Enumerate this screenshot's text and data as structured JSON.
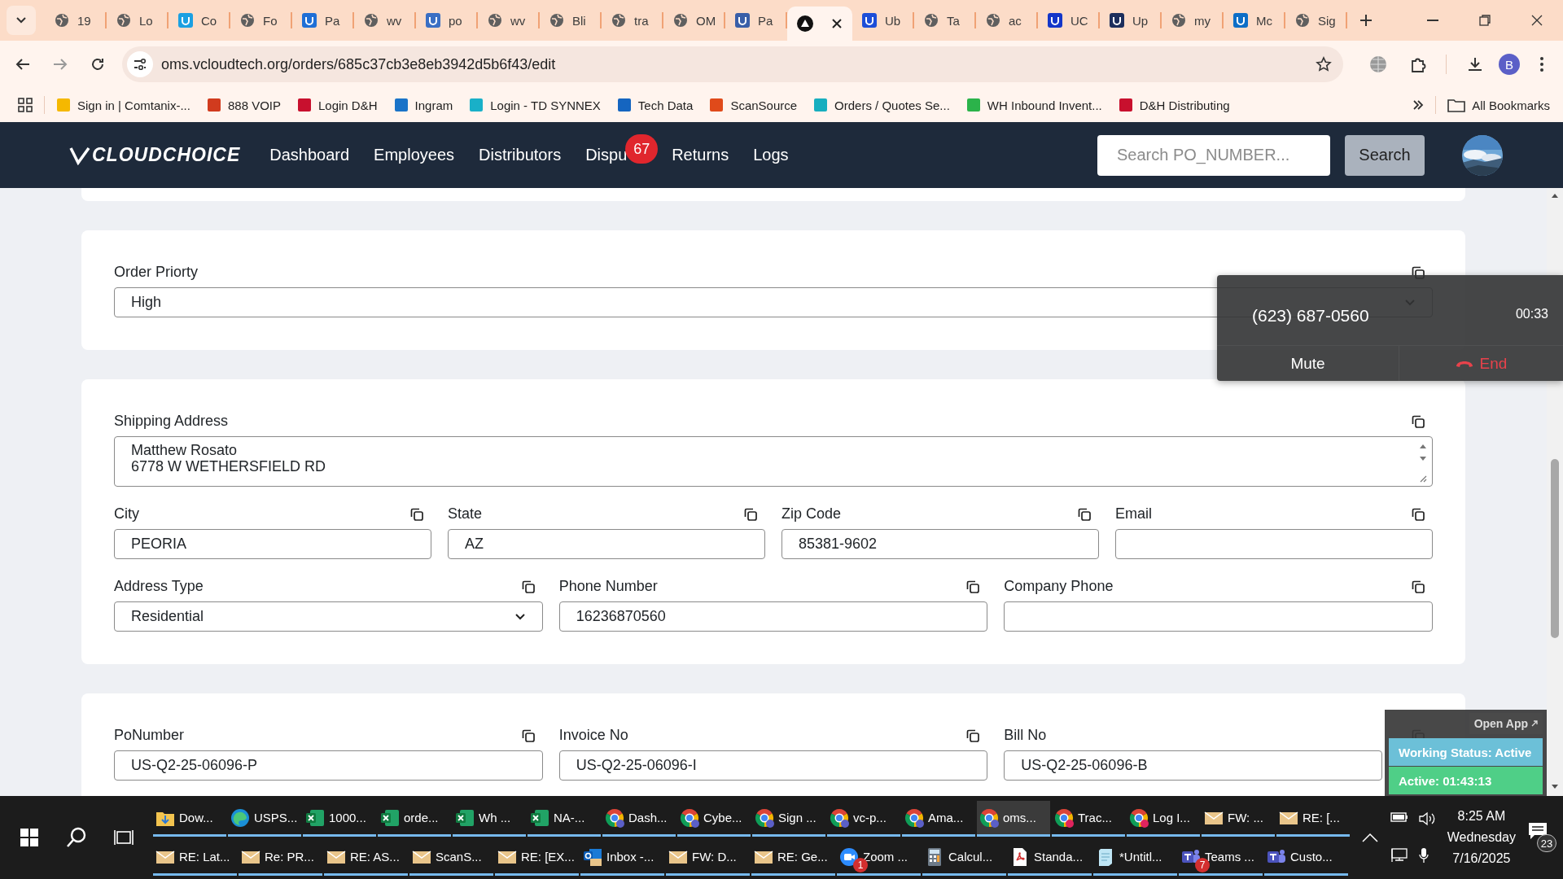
{
  "browser": {
    "tabs": [
      {
        "title": "19",
        "kind": "globe",
        "selected": false
      },
      {
        "title": "Lo",
        "kind": "globe",
        "selected": false
      },
      {
        "title": "Co",
        "kind": "favicon",
        "color": "#1ba0e2",
        "selected": false
      },
      {
        "title": "Fo",
        "kind": "globe",
        "selected": false
      },
      {
        "title": "Pa",
        "kind": "favicon",
        "color": "#1f6fd6",
        "selected": false
      },
      {
        "title": "wv",
        "kind": "globe",
        "selected": false
      },
      {
        "title": "po",
        "kind": "favicon",
        "color": "#3a6fc4",
        "selected": false
      },
      {
        "title": "wv",
        "kind": "globe",
        "selected": false
      },
      {
        "title": "Bli",
        "kind": "globe",
        "selected": false
      },
      {
        "title": "tra",
        "kind": "globe",
        "selected": false
      },
      {
        "title": "OM",
        "kind": "globe",
        "selected": false
      },
      {
        "title": "Pa",
        "kind": "favicon",
        "color": "#3a5fa8",
        "selected": false
      },
      {
        "kind": "app",
        "selected": true
      },
      {
        "title": "Ub",
        "kind": "favicon",
        "color": "#1d4ed8",
        "selected": false
      },
      {
        "title": "Ta",
        "kind": "globe",
        "selected": false
      },
      {
        "title": "ac",
        "kind": "globe",
        "selected": false
      },
      {
        "title": "UC",
        "kind": "favicon",
        "color": "#1436c9",
        "selected": false
      },
      {
        "title": "Up",
        "kind": "favicon",
        "color": "#1c2e5c",
        "selected": false
      },
      {
        "title": "my",
        "kind": "globe",
        "selected": false
      },
      {
        "title": "Mc",
        "kind": "favicon",
        "color": "#0d6ec7",
        "selected": false
      },
      {
        "title": "Sig",
        "kind": "globe",
        "selected": false
      }
    ],
    "url": "oms.vcloudtech.org/orders/685c37cb3e8eb3942d5b6f43/edit",
    "profile": "B"
  },
  "bookmarks": {
    "items": [
      {
        "label": "Sign in | Comtanix-...",
        "color": "#f5b800"
      },
      {
        "label": "888 VOIP",
        "color": "#d13b1e"
      },
      {
        "label": "Login D&H",
        "color": "#c8102e"
      },
      {
        "label": "Ingram",
        "color": "#1a73c8"
      },
      {
        "label": "Login - TD SYNNEX",
        "color": "#19b0c8"
      },
      {
        "label": "Tech Data",
        "color": "#1565c0"
      },
      {
        "label": "ScanSource",
        "color": "#e04a1a"
      },
      {
        "label": "Orders / Quotes Se...",
        "color": "#17aebf"
      },
      {
        "label": "WH Inbound Invent...",
        "color": "#2bb34a"
      },
      {
        "label": "D&H Distributing",
        "color": "#c8102e"
      }
    ],
    "all": "All Bookmarks"
  },
  "app": {
    "brand": "CLOUDCHOICE",
    "nav": [
      {
        "label": "Dashboard"
      },
      {
        "label": "Employees"
      },
      {
        "label": "Distributors"
      },
      {
        "label": "Dispu",
        "badge": "67"
      },
      {
        "label": "Returns"
      },
      {
        "label": "Logs"
      }
    ],
    "search": {
      "placeholder": "Search PO_NUMBER..."
    },
    "search_button": "Search"
  },
  "form": {
    "sections": [
      {
        "rows": [
          [
            {
              "label": "Order Priorty",
              "kind": "select",
              "value": "High"
            }
          ]
        ]
      },
      {
        "rows": [
          [
            {
              "label": "Shipping Address",
              "kind": "textarea",
              "value": "Matthew Rosato\n6778 W WETHERSFIELD RD"
            }
          ],
          [
            {
              "label": "City",
              "kind": "text",
              "value": "PEORIA"
            },
            {
              "label": "State",
              "kind": "text",
              "value": "AZ"
            },
            {
              "label": "Zip Code",
              "kind": "text",
              "value": "85381-9602"
            },
            {
              "label": "Email",
              "kind": "text"
            }
          ],
          [
            {
              "label": "Address Type",
              "kind": "select",
              "value": "Residential"
            },
            {
              "label": "Phone Number",
              "kind": "text",
              "value": "16236870560"
            },
            {
              "label": "Company Phone",
              "kind": "text"
            }
          ]
        ]
      },
      {
        "rows": [
          [
            {
              "label": "PoNumber",
              "kind": "text",
              "value": "US-Q2-25-06096-P"
            },
            {
              "label": "Invoice No",
              "kind": "text",
              "value": "US-Q2-25-06096-I"
            },
            {
              "label": "Bill No",
              "kind": "text",
              "value": "US-Q2-25-06096-B"
            }
          ]
        ]
      }
    ]
  },
  "call_widget": {
    "number": "(623) 687-0560",
    "timer": "00:33",
    "mute": "Mute",
    "end": "End"
  },
  "status_overlay": {
    "open_app": "Open App",
    "working_status": "Working Status: Active",
    "active_time": "Active: 01:43:13"
  },
  "taskbar": {
    "upper_row": [
      {
        "label": "Dow...",
        "kind": "folder",
        "selected": false
      },
      {
        "label": "USPS...",
        "kind": "edge",
        "selected": false
      },
      {
        "label": "1000...",
        "kind": "excel",
        "selected": false
      },
      {
        "label": "orde...",
        "kind": "excel",
        "selected": false
      },
      {
        "label": "Wh ...",
        "kind": "excel",
        "selected": false
      },
      {
        "label": "NA-...",
        "kind": "excel",
        "selected": false
      },
      {
        "label": "Dash...",
        "kind": "chrome",
        "selected": false
      },
      {
        "label": "Cybe...",
        "kind": "chrome",
        "selected": false
      },
      {
        "label": "Sign ...",
        "kind": "chrome",
        "selected": false
      },
      {
        "label": "vc-p...",
        "kind": "chrome",
        "selected": false
      },
      {
        "label": "Ama...",
        "kind": "chrome",
        "selected": false
      },
      {
        "label": "oms...",
        "kind": "chrome",
        "selected": true
      },
      {
        "label": "Trac...",
        "kind": "chrome-rec",
        "selected": false
      },
      {
        "label": "Log I...",
        "kind": "chrome-rec",
        "selected": false
      },
      {
        "label": "FW: ...",
        "kind": "mail",
        "selected": false
      },
      {
        "label": "RE: [...",
        "kind": "mail",
        "selected": false
      }
    ],
    "lower_row": [
      {
        "label": "RE: Lat...",
        "kind": "mail",
        "selected": false
      },
      {
        "label": "Re: PR...",
        "kind": "mail",
        "selected": false
      },
      {
        "label": "RE: AS...",
        "kind": "mail",
        "selected": false
      },
      {
        "label": "ScanS...",
        "kind": "mail",
        "selected": false
      },
      {
        "label": "RE: [EX...",
        "kind": "mail",
        "selected": false
      },
      {
        "label": "Inbox -...",
        "kind": "outlook",
        "selected": false
      },
      {
        "label": "FW: D...",
        "kind": "mail",
        "selected": false
      },
      {
        "label": "RE: Ge...",
        "kind": "mail",
        "selected": false
      },
      {
        "label": "Zoom ...",
        "kind": "zoom",
        "badge": "1",
        "selected": false
      },
      {
        "label": "Calcul...",
        "kind": "calc",
        "selected": false
      },
      {
        "label": "Standa...",
        "kind": "pdf",
        "selected": false
      },
      {
        "label": "*Untitl...",
        "kind": "notepad",
        "selected": false
      },
      {
        "label": "Teams ...",
        "kind": "teams",
        "badge": "7",
        "selected": false
      },
      {
        "label": "Custo...",
        "kind": "teams",
        "selected": false
      }
    ],
    "clock": {
      "time": "8:25 AM",
      "day": "Wednesday",
      "date": "7/16/2025"
    },
    "notifications": "23"
  }
}
